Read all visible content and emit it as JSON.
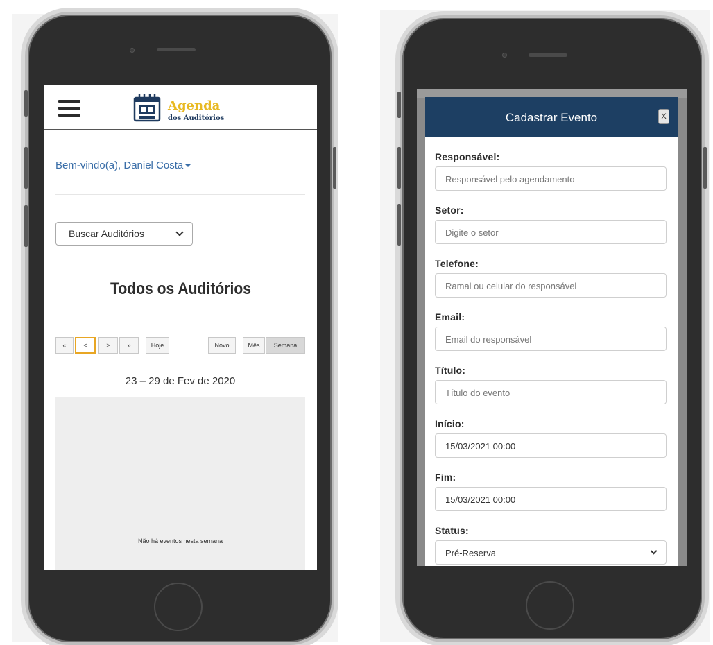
{
  "left_screen": {
    "logo": {
      "title": "Agenda",
      "subtitle": "dos Auditórios"
    },
    "welcome_text": "Bem-vindo(a), Daniel Costa",
    "auditorium_select": {
      "selected": "Buscar Auditórios"
    },
    "page_title": "Todos os Auditórios",
    "toolbar": {
      "first_label": "«",
      "prev_label": "<",
      "next_label": ">",
      "last_label": "»",
      "today_label": "Hoje",
      "new_label": "Novo",
      "month_label": "Mês",
      "week_label": "Semana"
    },
    "date_range": "23 – 29 de Fev de 2020",
    "empty_message": "Não há eventos nesta semana"
  },
  "right_screen": {
    "modal": {
      "title": "Cadastrar Evento",
      "close_label": "X",
      "fields": [
        {
          "label": "Responsável:",
          "placeholder": "Responsável pelo agendamento",
          "value": ""
        },
        {
          "label": "Setor:",
          "placeholder": "Digite o setor",
          "value": ""
        },
        {
          "label": "Telefone:",
          "placeholder": "Ramal ou celular do responsável",
          "value": ""
        },
        {
          "label": "Email:",
          "placeholder": "Email do responsável",
          "value": ""
        },
        {
          "label": "Título:",
          "placeholder": "Título do evento",
          "value": ""
        },
        {
          "label": "Início:",
          "placeholder": "",
          "value": "15/03/2021 00:00"
        },
        {
          "label": "Fim:",
          "placeholder": "",
          "value": "15/03/2021 00:00"
        },
        {
          "label": "Status:",
          "placeholder": "",
          "value": "Pré-Reserva"
        }
      ]
    }
  },
  "colors": {
    "brand_yellow": "#e8b923",
    "brand_navy": "#1d3f63",
    "link_blue": "#3a6ea8",
    "active_outline": "#e8a624"
  },
  "icons": [
    "hamburger-menu-icon",
    "calendar-logo-icon",
    "chevron-down-icon",
    "close-icon"
  ]
}
